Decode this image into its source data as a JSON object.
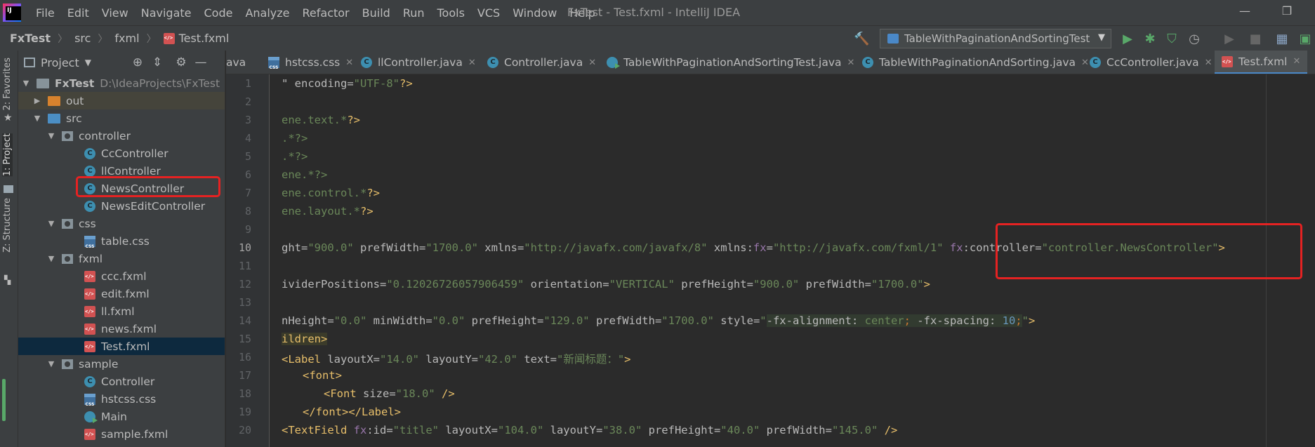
{
  "menu": [
    "File",
    "Edit",
    "View",
    "Navigate",
    "Code",
    "Analyze",
    "Refactor",
    "Build",
    "Run",
    "Tools",
    "VCS",
    "Window",
    "Help"
  ],
  "window_title": "FxTest - Test.fxml - IntelliJ IDEA",
  "window_controls": {
    "minimize": "—",
    "restore": "❐"
  },
  "breadcrumb": [
    "FxTest",
    "src",
    "fxml",
    "Test.fxml"
  ],
  "run_config": "TableWithPaginationAndSortingTest",
  "left_strip": {
    "favorites": "2: Favorites",
    "project": "1: Project",
    "structure": "Z: Structure"
  },
  "project_panel": {
    "title": "Project",
    "tree": [
      {
        "label": "FxTest",
        "path": "D:\\IdeaProjects\\FxTest",
        "type": "module"
      },
      {
        "label": "out",
        "type": "folder-orange"
      },
      {
        "label": "src",
        "type": "folder-blue"
      },
      {
        "label": "controller",
        "type": "package"
      },
      {
        "label": "CcController",
        "type": "class"
      },
      {
        "label": "llController",
        "type": "class"
      },
      {
        "label": "NewsController",
        "type": "class"
      },
      {
        "label": "NewsEditController",
        "type": "class"
      },
      {
        "label": "css",
        "type": "package"
      },
      {
        "label": "table.css",
        "type": "css"
      },
      {
        "label": "fxml",
        "type": "package"
      },
      {
        "label": "ccc.fxml",
        "type": "fxml"
      },
      {
        "label": "edit.fxml",
        "type": "fxml"
      },
      {
        "label": "ll.fxml",
        "type": "fxml"
      },
      {
        "label": "news.fxml",
        "type": "fxml"
      },
      {
        "label": "Test.fxml",
        "type": "fxml"
      },
      {
        "label": "sample",
        "type": "package"
      },
      {
        "label": "Controller",
        "type": "class"
      },
      {
        "label": "hstcss.css",
        "type": "css"
      },
      {
        "label": "Main",
        "type": "main"
      },
      {
        "label": "sample.fxml",
        "type": "fxml"
      }
    ]
  },
  "tabs": [
    "ava",
    "hstcss.css",
    "llController.java",
    "Controller.java",
    "TableWithPaginationAndSortingTest.java",
    "TableWithPaginationAndSorting.java",
    "CcController.java",
    "Test.fxml"
  ],
  "editor": {
    "line_numbers": [
      "1",
      "2",
      "3",
      "4",
      "5",
      "6",
      "7",
      "8",
      "9",
      "10",
      "11",
      "12",
      "13",
      "14",
      "15",
      "16",
      "17",
      "18",
      "19",
      "20"
    ],
    "lines": {
      "l1": {
        "a": "\" encoding=",
        "b": "\"UTF-8\"",
        "c": "?>"
      },
      "l3": {
        "a": "ene.text.*",
        "b": "?>"
      },
      "l4": ".*?>",
      "l5": ".*?>",
      "l6": "ene.*?>",
      "l7": {
        "a": "ene.control.*",
        "b": "?>"
      },
      "l8": {
        "a": "ene.layout.*",
        "b": "?>"
      },
      "l10": {
        "a1": "ght=",
        "v1": "\"900.0\"",
        "a2": " prefWidth=",
        "v2": "\"1700.0\"",
        "a3": " xmlns=",
        "v3": "\"http://javafx.com/javafx/8\"",
        "a4": " xmlns:",
        "ns4": "fx",
        "e4": "=",
        "v4": "\"http://javafx.com/fxml/1\"",
        "ns5": " fx",
        "a5": ":controller=",
        "v5": "\"controller.NewsController\"",
        "end": ">"
      },
      "l12": {
        "a1": "ividerPositions=",
        "v1": "\"0.12026726057906459\"",
        "a2": " orientation=",
        "v2": "\"VERTICAL\"",
        "a3": " prefHeight=",
        "v3": "\"900.0\"",
        "a4": " prefWidth=",
        "v4": "\"1700.0\"",
        "end": ">"
      },
      "l14": {
        "a1": "nHeight=",
        "v1": "\"0.0\"",
        "a2": " minWidth=",
        "v2": "\"0.0\"",
        "a3": " prefHeight=",
        "v3": "\"129.0\"",
        "a4": " prefWidth=",
        "v4": "\"1700.0\"",
        "a5": " style=",
        "q1": "\"",
        "css1": "-fx-alignment",
        "cp1": ": ",
        "cv1": "center",
        "cs1": ";",
        "css2": " -fx-spacing",
        "cp2": ": ",
        "cv2": "10",
        "cs2": ";",
        "q2": "\"",
        "end": ">"
      },
      "l15": "ildren>",
      "l16": {
        "t": "<Label",
        "a1": " layoutX=",
        "v1": "\"14.0\"",
        "a2": " layoutY=",
        "v2": "\"42.0\"",
        "a3": " text=",
        "v3": "\"新闻标题：\"",
        "end": ">"
      },
      "l17": "<font>",
      "l18": {
        "t": "<Font",
        "a1": " size=",
        "v1": "\"18.0\"",
        "end": " />"
      },
      "l19": "</font></Label>",
      "l20": {
        "t": "<TextField",
        "ns1": " fx",
        "a1": ":id=",
        "v1": "\"title\"",
        "a2": " layoutX=",
        "v2": "\"104.0\"",
        "a3": " layoutY=",
        "v3": "\"38.0\"",
        "a4": " prefHeight=",
        "v4": "\"40.0\"",
        "a5": " prefWidth=",
        "v5": "\"145.0\"",
        "end": " />"
      }
    }
  }
}
